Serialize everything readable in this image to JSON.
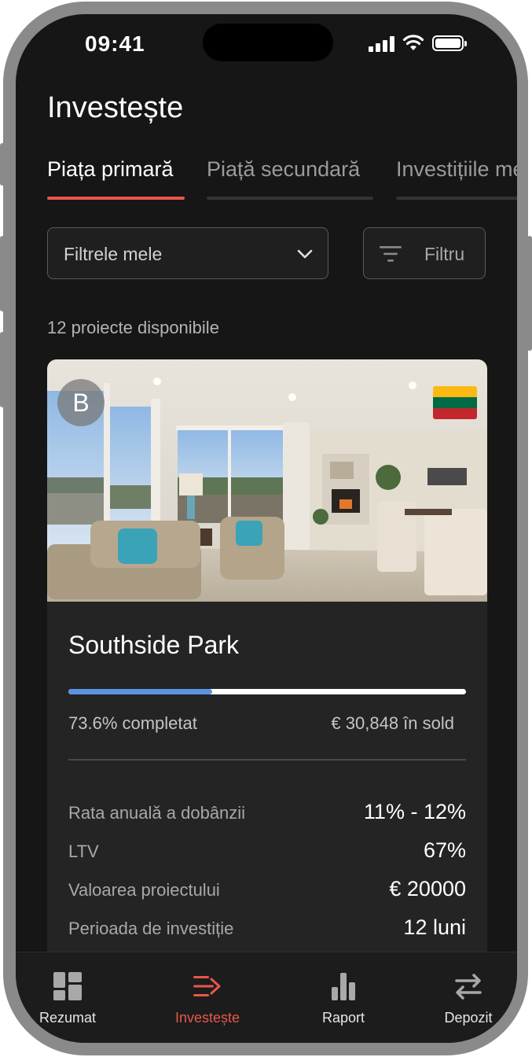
{
  "status_bar": {
    "time": "09:41"
  },
  "page": {
    "title": "Investește"
  },
  "tabs": [
    {
      "label": "Piața primară",
      "active": true
    },
    {
      "label": "Piață secundară",
      "active": false
    },
    {
      "label": "Investițiile mele",
      "active": false
    }
  ],
  "filters": {
    "my_filters_label": "Filtrele mele",
    "filter_button_label": "Filtru"
  },
  "projects_count_text": "12 proiecte disponibile",
  "project_card": {
    "avatar_letter": "B",
    "flag_country": "Lithuania",
    "flag_colors": [
      "#fdb913",
      "#006a44",
      "#c1272d"
    ],
    "name": "Southside Park",
    "progress_percent": 36.2,
    "completed_text": "73.6% completat",
    "balance_text": "€ 30,848 în sold",
    "details": [
      {
        "label": "Rata anuală a dobânzii",
        "value": "11% - 12%"
      },
      {
        "label": "LTV",
        "value": "67%"
      },
      {
        "label": "Valoarea proiectului",
        "value": "€ 20000"
      },
      {
        "label": "Perioada de investiție",
        "value": "12 luni"
      }
    ]
  },
  "bottom_nav": [
    {
      "label": "Rezumat",
      "icon": "dashboard-icon",
      "active": false
    },
    {
      "label": "Investește",
      "icon": "invest-icon",
      "active": true
    },
    {
      "label": "Raport",
      "icon": "bar-chart-icon",
      "active": false
    },
    {
      "label": "Depozit",
      "icon": "transfer-icon",
      "active": false
    }
  ],
  "colors": {
    "accent": "#e8574a",
    "progress": "#5b93e0",
    "background": "#161616",
    "card": "#242424"
  }
}
